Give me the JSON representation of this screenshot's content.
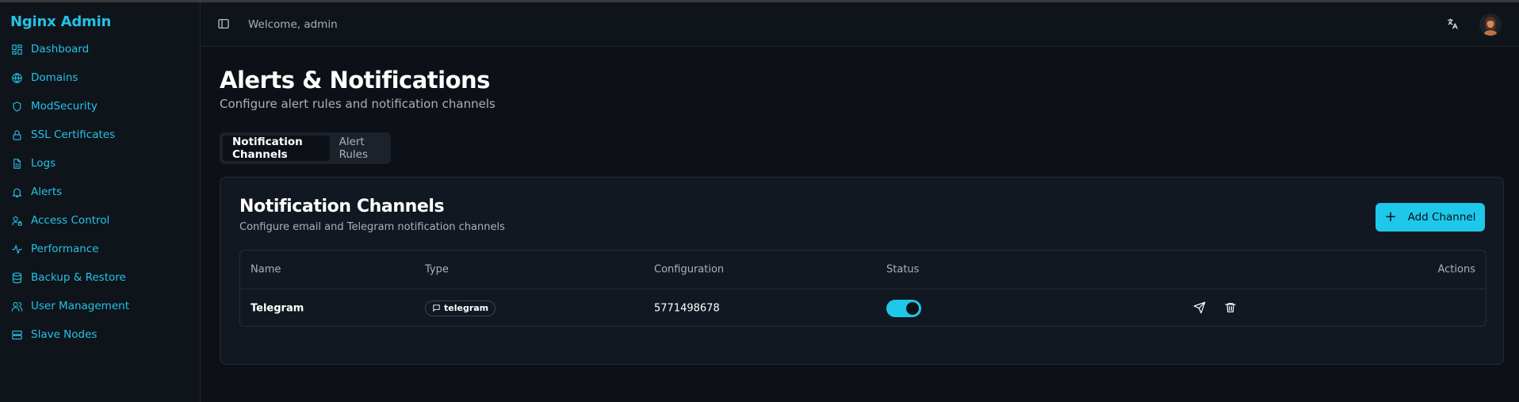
{
  "app": {
    "brand": "Nginx Admin"
  },
  "sidebar": {
    "items": [
      {
        "label": "Dashboard",
        "icon": "dashboard-icon"
      },
      {
        "label": "Domains",
        "icon": "globe-icon"
      },
      {
        "label": "ModSecurity",
        "icon": "shield-icon"
      },
      {
        "label": "SSL Certificates",
        "icon": "lock-icon"
      },
      {
        "label": "Logs",
        "icon": "file-text-icon"
      },
      {
        "label": "Alerts",
        "icon": "bell-icon"
      },
      {
        "label": "Access Control",
        "icon": "user-lock-icon"
      },
      {
        "label": "Performance",
        "icon": "activity-icon"
      },
      {
        "label": "Backup & Restore",
        "icon": "database-icon"
      },
      {
        "label": "User Management",
        "icon": "users-icon"
      },
      {
        "label": "Slave Nodes",
        "icon": "server-icon"
      }
    ]
  },
  "header": {
    "welcome": "Welcome, admin"
  },
  "page": {
    "title": "Alerts & Notifications",
    "subtitle": "Configure alert rules and notification channels",
    "tabs": [
      {
        "label": "Notification Channels",
        "active": true
      },
      {
        "label": "Alert Rules",
        "active": false
      }
    ]
  },
  "card": {
    "title": "Notification Channels",
    "subtitle": "Configure email and Telegram notification channels",
    "add_button": "Add Channel"
  },
  "table": {
    "columns": [
      "Name",
      "Type",
      "Configuration",
      "Status",
      "Actions"
    ],
    "rows": [
      {
        "name": "Telegram",
        "type": "telegram",
        "configuration": "5771498678",
        "status_enabled": true
      }
    ]
  },
  "colors": {
    "accent": "#1ec8ea",
    "background": "#0d1117",
    "sidebar": "#0f141b"
  }
}
